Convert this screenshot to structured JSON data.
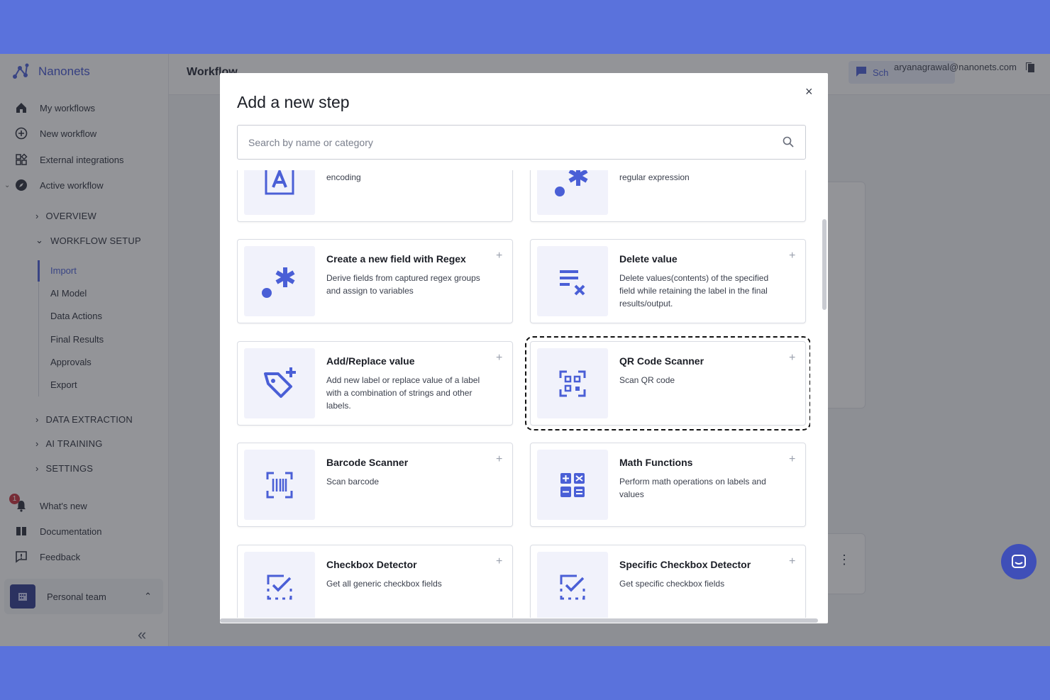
{
  "app": {
    "brand": "Nanonets",
    "page_title": "Workflow",
    "user_email": "aryanagrawal@nanonets.com",
    "schedule_button_label": "Sch",
    "colors": {
      "accent": "#4a5fd6",
      "band": "#5a72dc"
    }
  },
  "sidebar": {
    "primary": [
      {
        "label": "My workflows",
        "icon": "home-icon"
      },
      {
        "label": "New workflow",
        "icon": "plus-circle-icon"
      },
      {
        "label": "External integrations",
        "icon": "grid-icon"
      },
      {
        "label": "Active workflow",
        "icon": "compass-icon"
      }
    ],
    "tree": {
      "overview": "OVERVIEW",
      "workflow_setup": "WORKFLOW SETUP",
      "workflow_setup_items": [
        "Import",
        "AI Model",
        "Data Actions",
        "Final Results",
        "Approvals",
        "Export"
      ],
      "data_extraction": "DATA EXTRACTION",
      "ai_training": "AI TRAINING",
      "settings": "SETTINGS"
    },
    "footer": [
      {
        "label": "What's new",
        "icon": "bell-icon",
        "badge": "1"
      },
      {
        "label": "Documentation",
        "icon": "book-icon"
      },
      {
        "label": "Feedback",
        "icon": "feedback-icon"
      }
    ],
    "team": "Personal team"
  },
  "modal": {
    "title": "Add a new step",
    "close": "×",
    "search_placeholder": "Search by name or category",
    "cards": [
      {
        "title": "",
        "desc": "Convert a string into American Standard Code for Information Interchange encoding"
      },
      {
        "title": "",
        "desc": "Extract the substring matching the regular expression"
      },
      {
        "title": "Create a new field with Regex",
        "desc": "Derive fields from captured regex groups and assign to variables"
      },
      {
        "title": "Delete value",
        "desc": "Delete values(contents) of the specified field while retaining the label in the final results/output."
      },
      {
        "title": "Add/Replace value",
        "desc": "Add new label or replace value of a label with a combination of strings and other labels."
      },
      {
        "title": "QR Code Scanner",
        "desc": "Scan QR code"
      },
      {
        "title": "Barcode Scanner",
        "desc": "Scan barcode"
      },
      {
        "title": "Math Functions",
        "desc": "Perform math operations on labels and values"
      },
      {
        "title": "Checkbox Detector",
        "desc": "Get all generic checkbox fields"
      },
      {
        "title": "Specific Checkbox Detector",
        "desc": "Get specific checkbox fields"
      }
    ]
  }
}
